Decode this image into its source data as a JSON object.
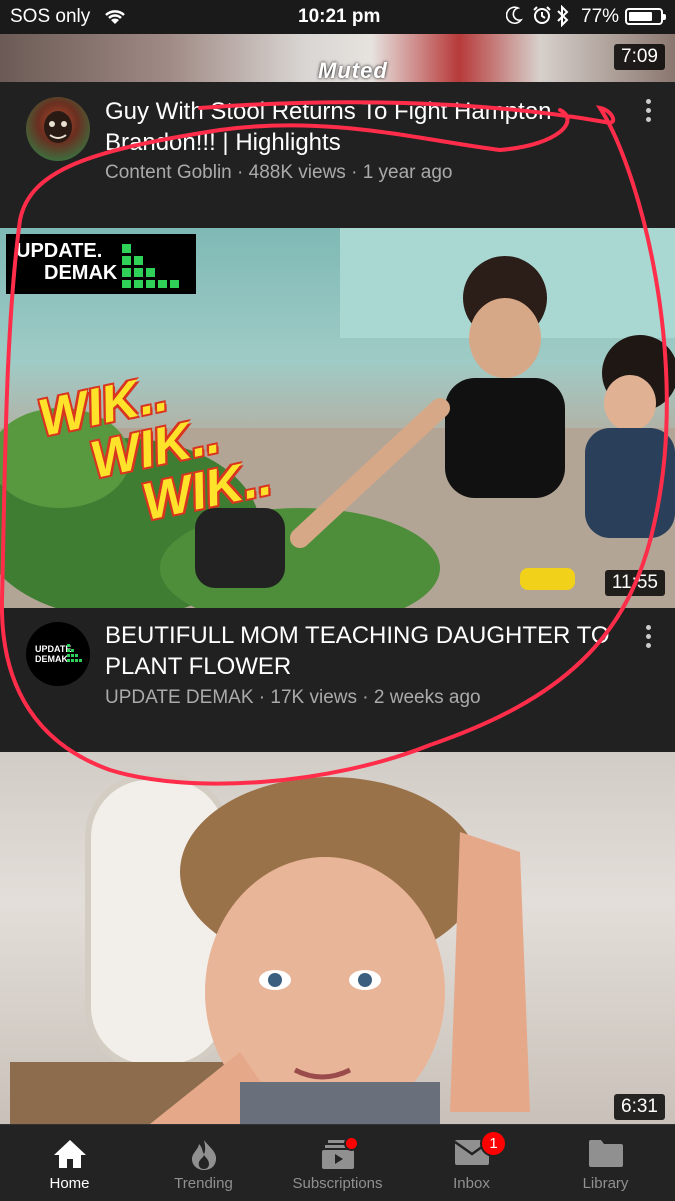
{
  "status_bar": {
    "carrier": "SOS only",
    "time": "10:21 pm",
    "battery": "77%",
    "battery_level": 0.77,
    "icons": [
      "wifi-icon",
      "moon-icon",
      "alarm-icon",
      "bluetooth-icon",
      "battery-icon"
    ]
  },
  "videos": [
    {
      "overlay_text": "Muted",
      "duration": "7:09",
      "title": "Guy With Stool Returns To Fight Hampton Brandon!!! | Highlights",
      "channel": "Content Goblin",
      "views": "488K views",
      "age": "1 year ago"
    },
    {
      "logo_text_1": "UPDATE.",
      "logo_text_2": "DEMAK",
      "overlay_lines": [
        "WIK..",
        "WIK..",
        "WIK.."
      ],
      "duration": "11:55",
      "title": "BEUTIFULL MOM TEACHING DAUGHTER TO PLANT FLOWER",
      "channel": "UPDATE DEMAK",
      "views": "17K views",
      "age": "2 weeks ago",
      "avatar_text_1": "UPDATE.",
      "avatar_text_2": "DEMAK"
    },
    {
      "duration": "6:31"
    }
  ],
  "meta_separator": "·",
  "nav": {
    "items": [
      {
        "label": "Home",
        "icon": "home-icon",
        "active": true
      },
      {
        "label": "Trending",
        "icon": "flame-icon"
      },
      {
        "label": "Subscriptions",
        "icon": "subscriptions-icon",
        "badge_dot": true
      },
      {
        "label": "Inbox",
        "icon": "mail-icon",
        "badge": "1"
      },
      {
        "label": "Library",
        "icon": "folder-icon"
      }
    ]
  },
  "colors": {
    "background": "#212121",
    "annotation": "#ff2d4a",
    "badge": "#ff0000",
    "meta_text": "#aaaaaa"
  }
}
